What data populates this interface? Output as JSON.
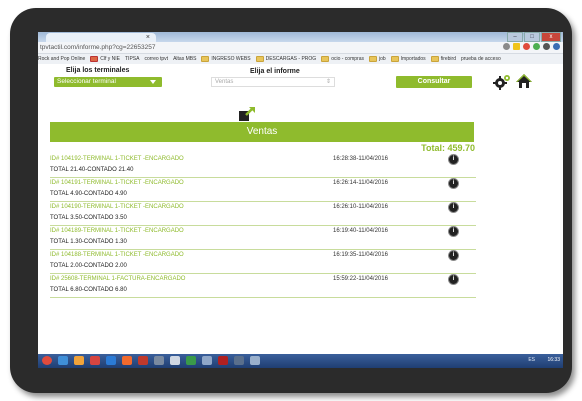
{
  "browser": {
    "tab_title": "",
    "tab_close": "×",
    "url": "tpvtactil.com/informe.php?cg=22653257",
    "window_controls": {
      "minimize": "–",
      "maximize": "□",
      "close": "x"
    },
    "bookmarks": [
      {
        "label": "Rock and Pop Online",
        "icon": "page-icon"
      },
      {
        "label": "Clf y NIE",
        "icon": "page-icon"
      },
      {
        "label": "TIPSA",
        "icon": "page-icon"
      },
      {
        "label": "correo tpvt",
        "icon": "mail-icon"
      },
      {
        "label": "Altas MBS",
        "icon": "page-icon"
      },
      {
        "label": "INGRESO WEBS",
        "icon": "folder-icon"
      },
      {
        "label": "DESCARGAS - PROG",
        "icon": "folder-icon"
      },
      {
        "label": "ocio - compras",
        "icon": "folder-icon"
      },
      {
        "label": "job",
        "icon": "folder-icon"
      },
      {
        "label": "Importados",
        "icon": "folder-icon"
      },
      {
        "label": "firebird",
        "icon": "folder-icon"
      },
      {
        "label": "prueba de acceso",
        "icon": "page-icon"
      }
    ]
  },
  "toolbar": {
    "terminals_label": "Elija los terminales",
    "terminals_value": "Seleccionar terminal",
    "report_label": "Elija el informe",
    "report_value": "Ventas",
    "report_caret": "⇕",
    "consult_label": "Consultar"
  },
  "report": {
    "banner": "Ventas",
    "total": "Total: 459.70",
    "rows": [
      {
        "id": "ID# 104192-TERMINAL 1-TICKET -ENCARGADO",
        "datetime": "16:28:38-11/04/2016",
        "total": "TOTAL 21.40-CONTADO 21.40"
      },
      {
        "id": "ID# 104191-TERMINAL 1-TICKET -ENCARGADO",
        "datetime": "16:26:14-11/04/2016",
        "total": "TOTAL 4.90-CONTADO 4.90"
      },
      {
        "id": "ID# 104190-TERMINAL 1-TICKET -ENCARGADO",
        "datetime": "16:26:10-11/04/2016",
        "total": "TOTAL 3.50-CONTADO 3.50"
      },
      {
        "id": "ID# 104189-TERMINAL 1-TICKET -ENCARGADO",
        "datetime": "16:19:40-11/04/2016",
        "total": "TOTAL 1.30-CONTADO 1.30"
      },
      {
        "id": "ID# 104188-TERMINAL 1-TICKET -ENCARGADO",
        "datetime": "16:19:35-11/04/2016",
        "total": "TOTAL 2.00-CONTADO 2.00"
      },
      {
        "id": "ID# 25608-TERMINAL 1-FACTURA-ENCARGADO",
        "datetime": "15:59:22-11/04/2016",
        "total": "TOTAL 6.80-CONTADO 6.80"
      }
    ],
    "info_glyph": "i"
  },
  "taskbar": {
    "clock": "16:33",
    "tray": "ES"
  },
  "colors": {
    "accent": "#8fbb2d",
    "row_divider": "#c8dc9c",
    "bezel": "#2b2b2b"
  }
}
